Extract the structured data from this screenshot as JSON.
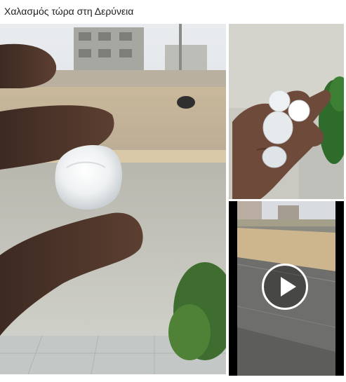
{
  "post": {
    "text": "Χαλασμός τώρα στη Δερύνεια"
  },
  "media": {
    "main_photo_icon": "photo-hailstone-fingers",
    "side_photo_icon": "photo-hailstones-palm",
    "video_icon": "play-icon"
  },
  "colors": {
    "page_bg": "#ffffff",
    "text": "#1c1e21",
    "divider": "#dddfe2",
    "play_ring": "#ffffff"
  }
}
